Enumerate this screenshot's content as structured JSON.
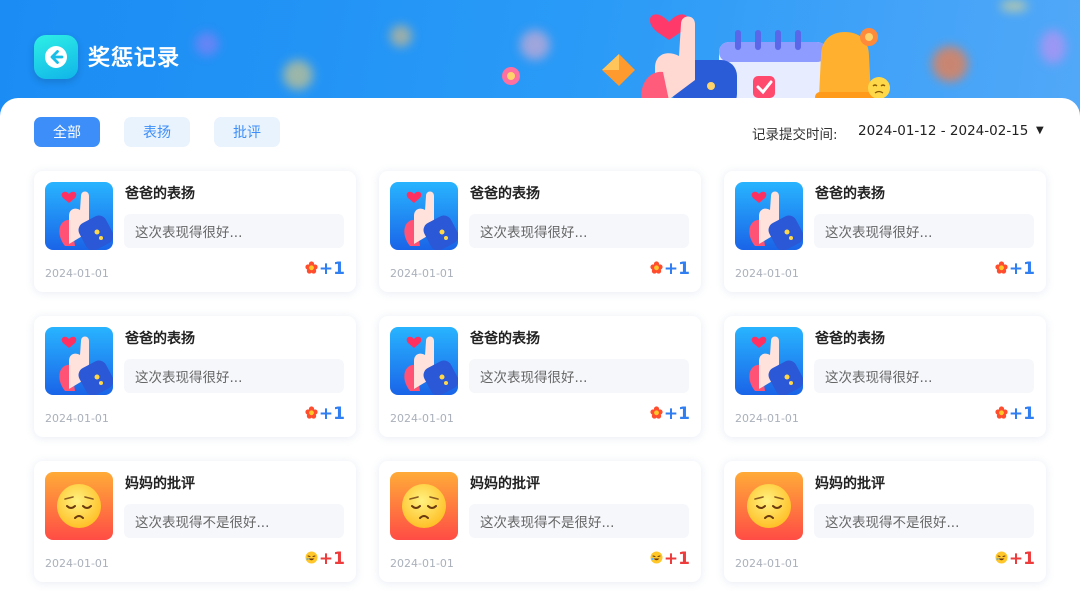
{
  "header": {
    "title": "奖惩记录"
  },
  "tabs": [
    {
      "label": "全部",
      "active": true
    },
    {
      "label": "表扬",
      "active": false
    },
    {
      "label": "批评",
      "active": false
    }
  ],
  "filter": {
    "label": "记录提交时间:",
    "value": "2024-01-12 - 2024-02-15"
  },
  "colors": {
    "primary": "#3d8ef8",
    "praise_points": "#2f7ef2",
    "criticism_points": "#ee3b3b"
  },
  "records": [
    {
      "type": "praise",
      "icon": "thumbs-up-icon",
      "title": "爸爸的表扬",
      "message": "这次表现得很好...",
      "date": "2024-01-01",
      "badge_icon": "flower-icon",
      "points": "+1"
    },
    {
      "type": "praise",
      "icon": "thumbs-up-icon",
      "title": "爸爸的表扬",
      "message": "这次表现得很好...",
      "date": "2024-01-01",
      "badge_icon": "flower-icon",
      "points": "+1"
    },
    {
      "type": "praise",
      "icon": "thumbs-up-icon",
      "title": "爸爸的表扬",
      "message": "这次表现得很好...",
      "date": "2024-01-01",
      "badge_icon": "flower-icon",
      "points": "+1"
    },
    {
      "type": "praise",
      "icon": "thumbs-up-icon",
      "title": "爸爸的表扬",
      "message": "这次表现得很好...",
      "date": "2024-01-01",
      "badge_icon": "flower-icon",
      "points": "+1"
    },
    {
      "type": "praise",
      "icon": "thumbs-up-icon",
      "title": "爸爸的表扬",
      "message": "这次表现得很好...",
      "date": "2024-01-01",
      "badge_icon": "flower-icon",
      "points": "+1"
    },
    {
      "type": "praise",
      "icon": "thumbs-up-icon",
      "title": "爸爸的表扬",
      "message": "这次表现得很好...",
      "date": "2024-01-01",
      "badge_icon": "flower-icon",
      "points": "+1"
    },
    {
      "type": "criticism",
      "icon": "sad-face-icon",
      "title": "妈妈的批评",
      "message": "这次表现得不是很好...",
      "date": "2024-01-01",
      "badge_icon": "laughing-emoji-icon",
      "points": "+1"
    },
    {
      "type": "criticism",
      "icon": "sad-face-icon",
      "title": "妈妈的批评",
      "message": "这次表现得不是很好...",
      "date": "2024-01-01",
      "badge_icon": "laughing-emoji-icon",
      "points": "+1"
    },
    {
      "type": "criticism",
      "icon": "sad-face-icon",
      "title": "妈妈的批评",
      "message": "这次表现得不是很好...",
      "date": "2024-01-01",
      "badge_icon": "laughing-emoji-icon",
      "points": "+1"
    }
  ]
}
